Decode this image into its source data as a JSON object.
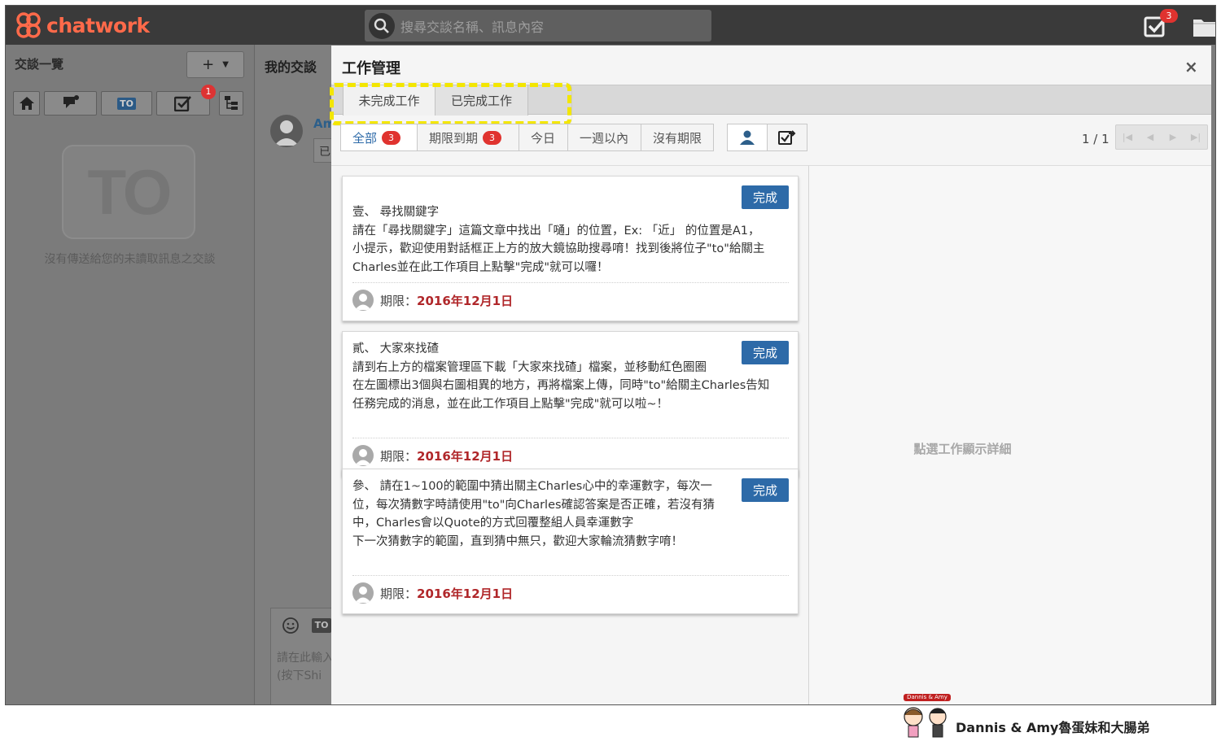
{
  "header": {
    "logo_text": "chatwork",
    "search_placeholder": "搜尋交談名稱、訊息內容",
    "task_badge": "3",
    "brand_color": "#ff6a4a"
  },
  "sidebar": {
    "title": "交談一覽",
    "add_label": "+",
    "filter_badge": "1",
    "filters": [
      {
        "icon": "home-icon"
      },
      {
        "icon": "mention-icon"
      },
      {
        "icon": "to-icon",
        "label": "TO"
      },
      {
        "icon": "task-check-icon"
      }
    ],
    "empty_icon_text": "TO",
    "empty_text": "沒有傳送給您的未讀取訊息之交談"
  },
  "chat": {
    "title": "我的交談",
    "sender_name": "Am",
    "message_preview": "已",
    "to_label": "TO",
    "input_placeholder_line1": "請在此輸入",
    "input_placeholder_line2": "(按下Shi"
  },
  "modal": {
    "title": "工作管理",
    "close_label": "×",
    "tabs": [
      {
        "label": "未完成工作",
        "active": true
      },
      {
        "label": "已完成工作",
        "active": false
      }
    ],
    "filters": [
      {
        "label": "全部",
        "badge": "3"
      },
      {
        "label": "期限到期",
        "badge": "3"
      },
      {
        "label": "今日"
      },
      {
        "label": "一週以內"
      },
      {
        "label": "沒有期限"
      }
    ],
    "pagination": "1 / 1",
    "detail_hint": "點選工作顯示詳細",
    "tasks": [
      {
        "done_label": "完成",
        "lines": [
          "壹、 尋找關鍵字",
          "請在「尋找關鍵字」這篇文章中找出「嗵」的位置，Ex: 「近」 的位置是A1，",
          "小提示，歡迎使用對話框正上方的放大鏡協助搜尋唷！找到後將位子\"to\"給關主",
          "Charles並在此工作項目上點擊\"完成\"就可以囉！"
        ],
        "due_label": "期限：",
        "due_date": "2016年12月1日"
      },
      {
        "done_label": "完成",
        "lines": [
          "貳、 大家來找碴",
          "請到右上方的檔案管理區下載「大家來找碴」檔案，並移動紅色圈圈",
          "在左圖標出3個與右圖相異的地方，再將檔案上傳，同時\"to\"給關主Charles告知",
          "任務完成的消息，並在此工作項目上點擊\"完成\"就可以啦~！"
        ],
        "due_label": "期限：",
        "due_date": "2016年12月1日"
      },
      {
        "done_label": "完成",
        "lines": [
          "參、 請在1~100的範圍中猜出關主Charles心中的幸運數字，每次一",
          "位，每次猜數字時請使用\"to\"向Charles確認答案是否正確，若沒有猜",
          "中，Charles會以Quote的方式回覆整組人員幸運數字",
          "下一次猜數字的範圍，直到猜中無只，歡迎大家輪流猜數字唷！"
        ],
        "due_label": "期限：",
        "due_date": "2016年12月1日"
      }
    ]
  },
  "watermark": {
    "tag": "Dannis & Amy",
    "text": "Dannis & Amy魯蛋妹和大腸弟"
  }
}
